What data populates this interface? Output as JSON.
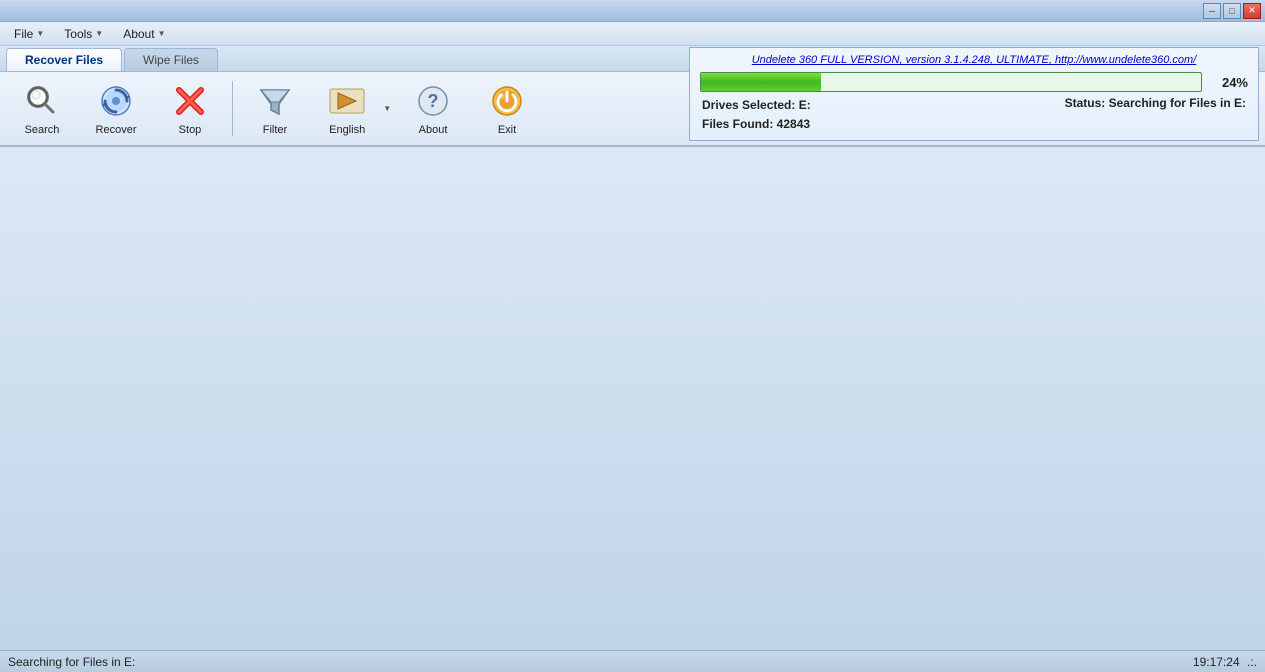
{
  "titlebar": {
    "minimize_label": "─",
    "restore_label": "□",
    "close_label": "✕"
  },
  "menubar": {
    "items": [
      {
        "label": "File",
        "has_arrow": true
      },
      {
        "label": "Tools",
        "has_arrow": true
      },
      {
        "label": "About",
        "has_arrow": true
      }
    ]
  },
  "tabs": [
    {
      "label": "Recover Files",
      "active": true
    },
    {
      "label": "Wipe Files",
      "active": false
    }
  ],
  "toolbar": {
    "buttons": [
      {
        "id": "search",
        "label": "Search",
        "disabled": false
      },
      {
        "id": "recover",
        "label": "Recover",
        "disabled": false
      },
      {
        "id": "stop",
        "label": "Stop",
        "disabled": false
      },
      {
        "id": "filter",
        "label": "Filter",
        "disabled": false
      },
      {
        "id": "english",
        "label": "English",
        "disabled": false,
        "has_arrow": true
      },
      {
        "id": "about",
        "label": "About",
        "disabled": false
      },
      {
        "id": "exit",
        "label": "Exit",
        "disabled": false
      }
    ]
  },
  "infopanel": {
    "version_text": "Undelete 360 FULL VERSION, version 3.1.4.248, ULTIMATE, http://www.undelete360.com/",
    "progress_percent": "24%",
    "progress_value": 24,
    "drives_label": "Drives Selected:",
    "drives_value": "E:",
    "files_found_label": "Files Found:",
    "files_found_value": "42843",
    "status_label": "Status:",
    "status_value": "Searching for Files in E:"
  },
  "statusbar": {
    "left_text": "Searching for Files in E:",
    "right_text": "19:17:24",
    "right_suffix": ".:."
  }
}
